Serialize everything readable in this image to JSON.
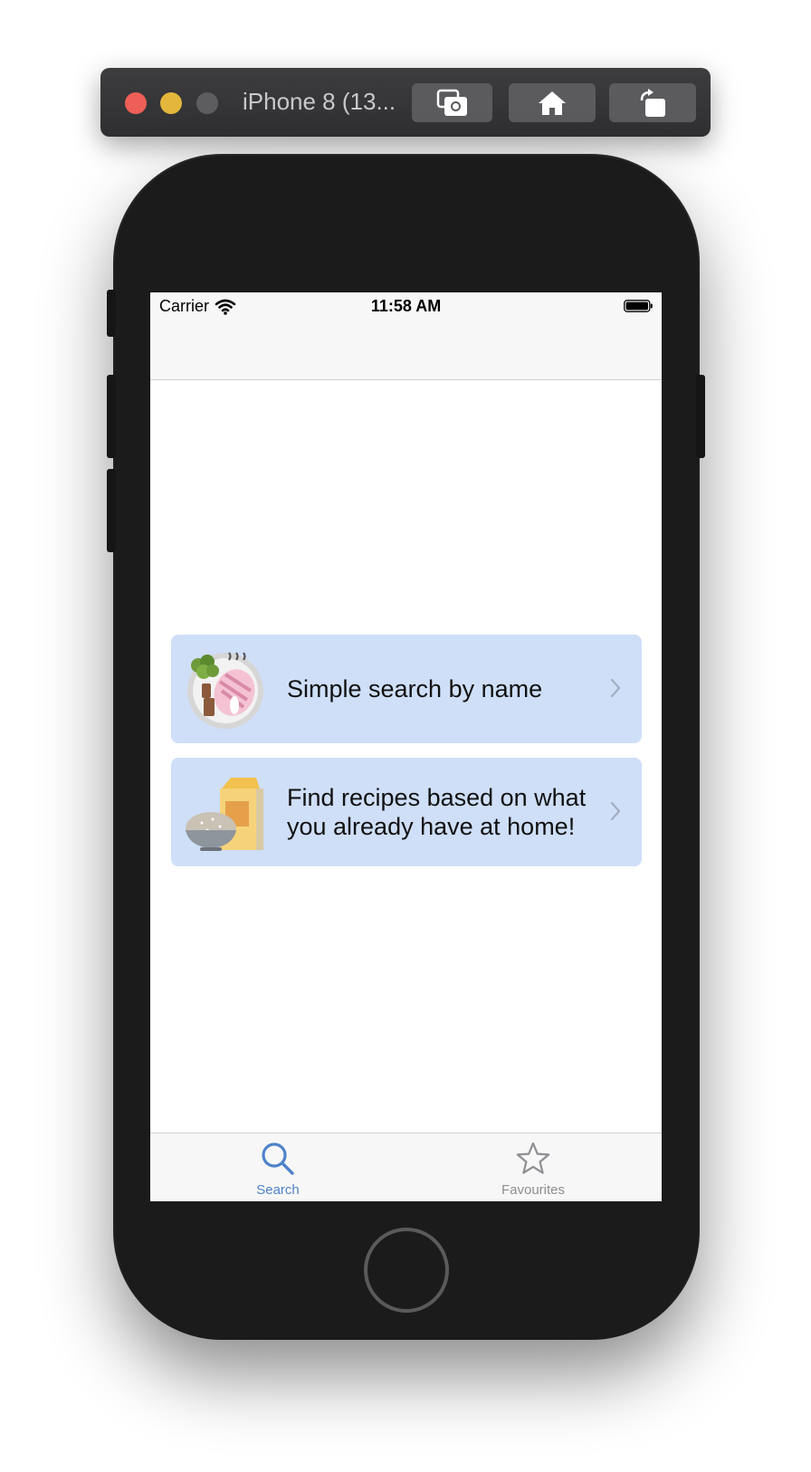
{
  "simulator": {
    "title": "iPhone 8 (13...",
    "buttons": [
      "screenshot-icon",
      "home-icon",
      "rotate-icon"
    ]
  },
  "status_bar": {
    "carrier": "Carrier",
    "time": "11:58 AM"
  },
  "menu": {
    "items": [
      {
        "label": "Simple search by name",
        "icon": "dish-icon"
      },
      {
        "label": "Find recipes based on what you already have at home!",
        "icon": "pantry-icon"
      }
    ]
  },
  "tab_bar": {
    "tabs": [
      {
        "label": "Search",
        "icon": "search-icon",
        "selected": true
      },
      {
        "label": "Favourites",
        "icon": "star-icon",
        "selected": false
      }
    ]
  },
  "colors": {
    "card_background": "#cfdff8",
    "tab_active": "#4f83c9",
    "tab_inactive": "#8e8e93"
  }
}
